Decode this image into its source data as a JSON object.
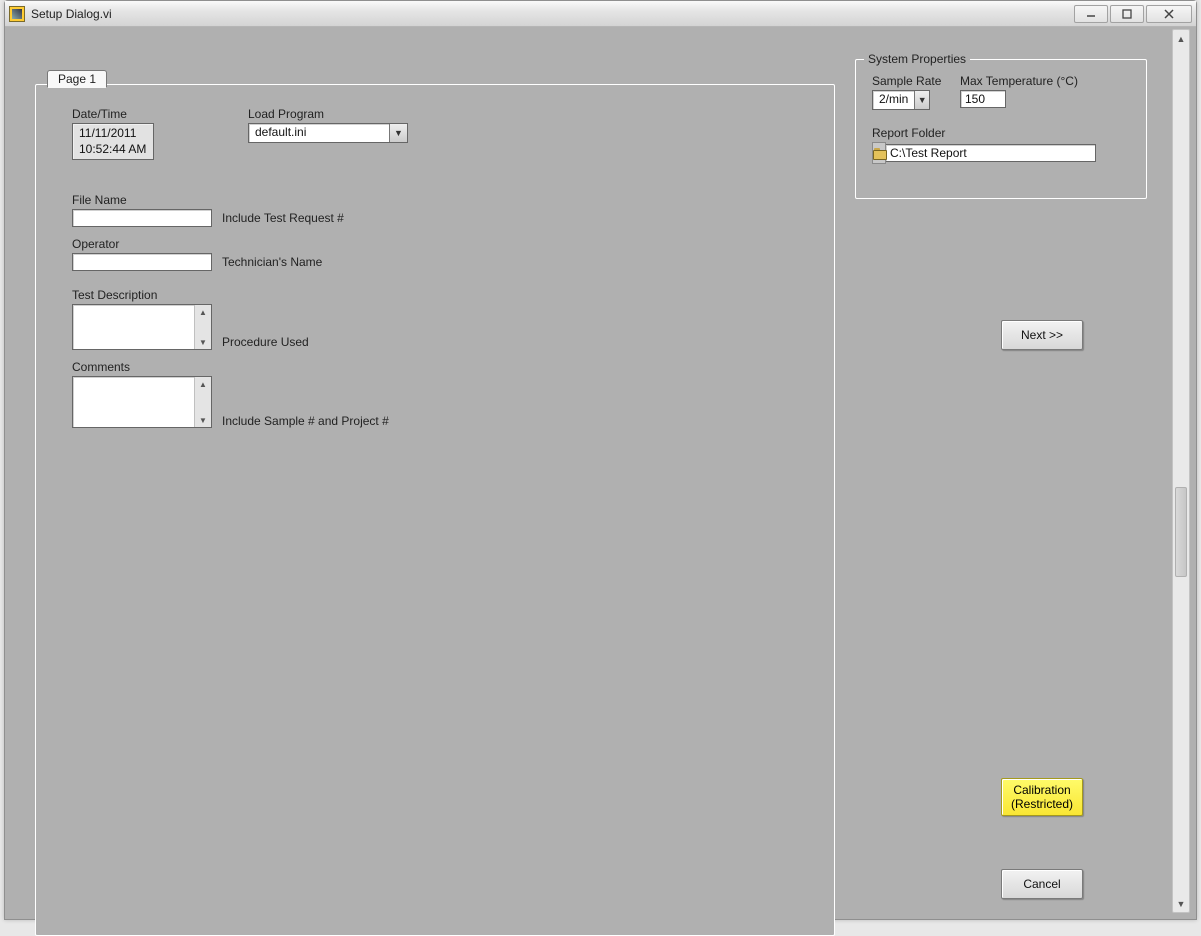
{
  "window": {
    "title": "Setup Dialog.vi"
  },
  "tabs": {
    "page1": "Page 1"
  },
  "labels": {
    "datetime": "Date/Time",
    "loadProgram": "Load Program",
    "fileName": "File Name",
    "fileNameHint": "Include Test Request #",
    "operator": "Operator",
    "operatorHint": "Technician's Name",
    "testDesc": "Test Description",
    "testDescHint": "Procedure Used",
    "comments": "Comments",
    "commentsHint": "Include Sample # and Project #",
    "systemProps": "System Properties",
    "sampleRate": "Sample Rate",
    "maxTemp": "Max Temperature (°C)",
    "reportFolder": "Report Folder"
  },
  "values": {
    "date": "11/11/2011",
    "time": "10:52:44 AM",
    "loadProgram": "default.ini",
    "fileName": "",
    "operator": "",
    "testDesc": "",
    "comments": "",
    "sampleRate": "2/min",
    "maxTemp": "150",
    "reportFolder": "C:\\Test Report"
  },
  "buttons": {
    "next": "Next >>",
    "calibration_l1": "Calibration",
    "calibration_l2": "(Restricted)",
    "cancel": "Cancel"
  }
}
